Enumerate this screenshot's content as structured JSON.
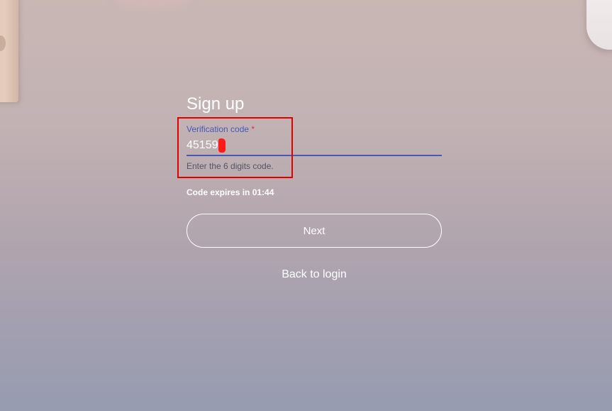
{
  "page": {
    "title": "Sign up"
  },
  "verification": {
    "label": "Verification code",
    "required_mark": "*",
    "value": "45159",
    "helper": "Enter the 6 digits code."
  },
  "timer": {
    "text": "Code expires in 01:44"
  },
  "actions": {
    "next_label": "Next",
    "back_label": "Back to login"
  },
  "colors": {
    "accent": "#4a58b8",
    "required": "#d03a4a",
    "annotation": "#e00000",
    "text_primary": "#ffffff"
  },
  "icons": {
    "redacted_digit": "red-scribble-mark"
  }
}
